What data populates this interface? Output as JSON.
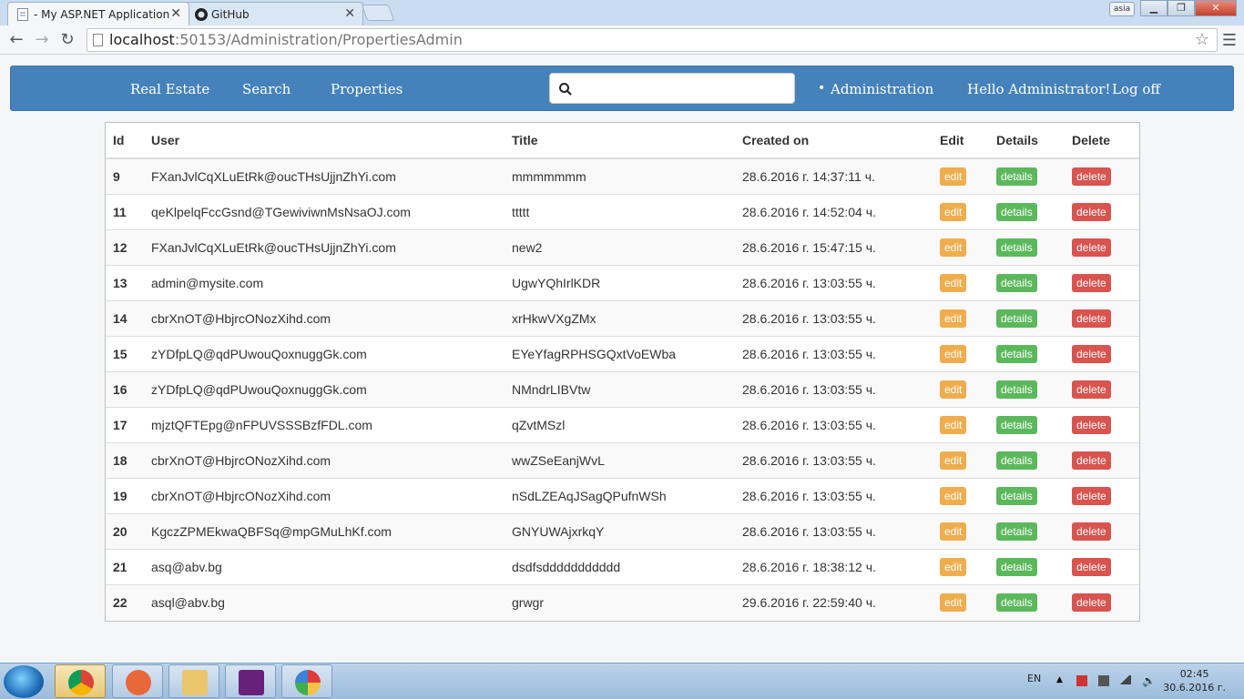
{
  "browser": {
    "tabs": [
      {
        "title": "- My ASP.NET Application",
        "active": true
      },
      {
        "title": "GitHub",
        "active": false
      }
    ],
    "user_badge": "asia",
    "url_host": "localhost",
    "url_path": ":50153/Administration/PropertiesAdmin"
  },
  "navbar": {
    "links": [
      "Real Estate",
      "Search",
      "Properties"
    ],
    "search_placeholder": "",
    "admin_link": "Administration",
    "greeting": "Hello Administrator!",
    "logoff": "Log off"
  },
  "table": {
    "headers": [
      "Id",
      "User",
      "Title",
      "Created on",
      "Edit",
      "Details",
      "Delete"
    ],
    "button_labels": {
      "edit": "edit",
      "details": "details",
      "delete": "delete"
    },
    "rows": [
      {
        "id": "9",
        "user": "FXanJvlCqXLuEtRk@oucTHsUjjnZhYi.com",
        "title": "mmmmmmm",
        "created": "28.6.2016 г. 14:37:11 ч."
      },
      {
        "id": "11",
        "user": "qeKlpelqFccGsnd@TGewiviwnMsNsaOJ.com",
        "title": "ttttt",
        "created": "28.6.2016 г. 14:52:04 ч."
      },
      {
        "id": "12",
        "user": "FXanJvlCqXLuEtRk@oucTHsUjjnZhYi.com",
        "title": "new2",
        "created": "28.6.2016 г. 15:47:15 ч."
      },
      {
        "id": "13",
        "user": "admin@mysite.com",
        "title": "UgwYQhIrlKDR",
        "created": "28.6.2016 г. 13:03:55 ч."
      },
      {
        "id": "14",
        "user": "cbrXnOT@HbjrcONozXihd.com",
        "title": "xrHkwVXgZMx",
        "created": "28.6.2016 г. 13:03:55 ч."
      },
      {
        "id": "15",
        "user": "zYDfpLQ@qdPUwouQoxnuggGk.com",
        "title": "EYeYfagRPHSGQxtVoEWba",
        "created": "28.6.2016 г. 13:03:55 ч."
      },
      {
        "id": "16",
        "user": "zYDfpLQ@qdPUwouQoxnuggGk.com",
        "title": "NMndrLIBVtw",
        "created": "28.6.2016 г. 13:03:55 ч."
      },
      {
        "id": "17",
        "user": "mjztQFTEpg@nFPUVSSSBzfFDL.com",
        "title": "qZvtMSzl",
        "created": "28.6.2016 г. 13:03:55 ч."
      },
      {
        "id": "18",
        "user": "cbrXnOT@HbjrcONozXihd.com",
        "title": "wwZSeEanjWvL",
        "created": "28.6.2016 г. 13:03:55 ч."
      },
      {
        "id": "19",
        "user": "cbrXnOT@HbjrcONozXihd.com",
        "title": "nSdLZEAqJSagQPufnWSh",
        "created": "28.6.2016 г. 13:03:55 ч."
      },
      {
        "id": "20",
        "user": "KgczZPMEkwaQBFSq@mpGMuLhKf.com",
        "title": "GNYUWAjxrkqY",
        "created": "28.6.2016 г. 13:03:55 ч."
      },
      {
        "id": "21",
        "user": "asq@abv.bg",
        "title": "dsdfsddddddddddd",
        "created": "28.6.2016 г. 18:38:12 ч."
      },
      {
        "id": "22",
        "user": "asql@abv.bg",
        "title": "grwgr",
        "created": "29.6.2016 г. 22:59:40 ч."
      }
    ]
  },
  "taskbar": {
    "language": "EN",
    "time": "02:45",
    "date": "30.6.2016 г."
  }
}
